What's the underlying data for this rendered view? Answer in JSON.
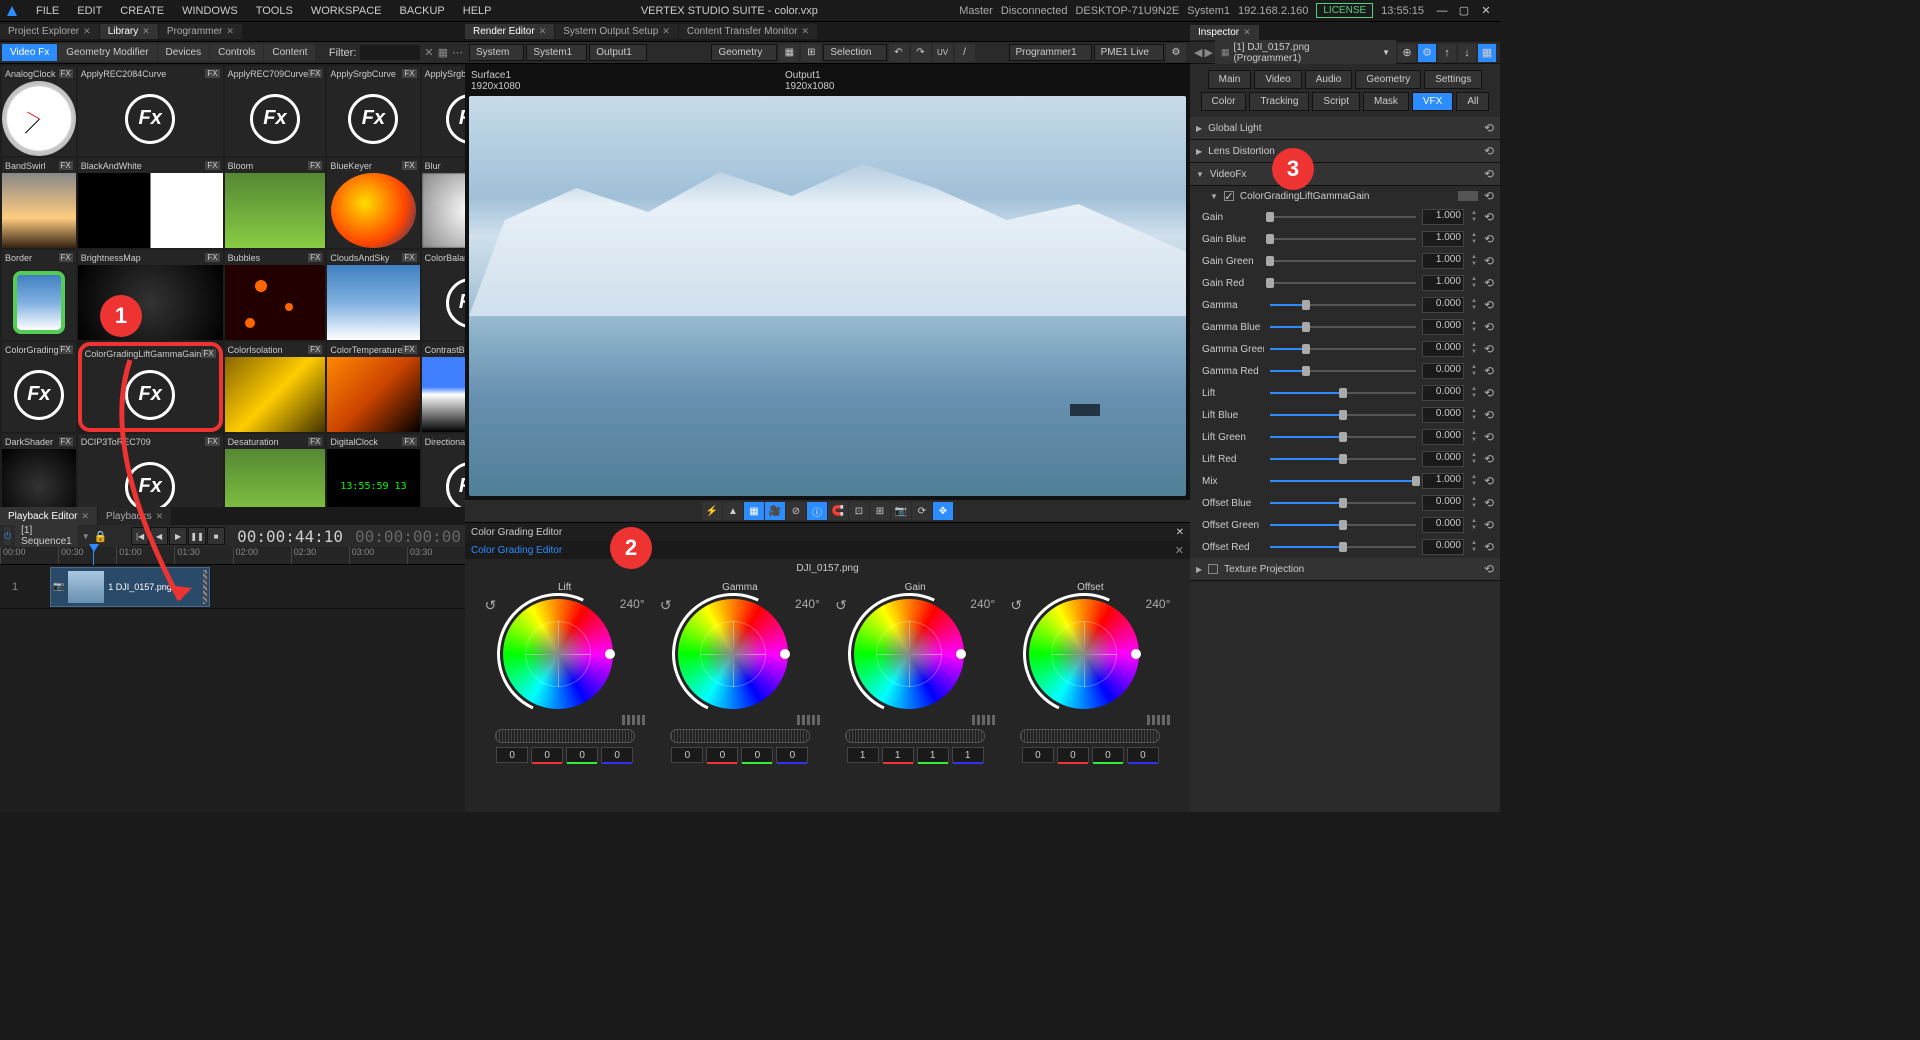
{
  "app": {
    "title": "VERTEX STUDIO SUITE - color.vxp",
    "status_master": "Master",
    "status_disconnected": "Disconnected",
    "status_machine": "DESKTOP-71U9N2E",
    "status_system": "System1",
    "status_ip": "192.168.2.160",
    "license": "LICENSE",
    "clock": "13:55:15"
  },
  "menu": [
    "FILE",
    "EDIT",
    "CREATE",
    "WINDOWS",
    "TOOLS",
    "WORKSPACE",
    "BACKUP",
    "HELP"
  ],
  "left_panel": {
    "tabs": [
      "Project Explorer",
      "Library",
      "Programmer"
    ],
    "active_tab": 1,
    "sub_tabs": [
      "Video Fx",
      "Geometry Modifier",
      "Devices",
      "Controls",
      "Content"
    ],
    "active_sub": 0,
    "filter_label": "Filter:",
    "fx_items": [
      {
        "name": "AnalogClock",
        "thumb": "clock"
      },
      {
        "name": "ApplyREC2084Curve",
        "thumb": "fx"
      },
      {
        "name": "ApplyREC709Curve",
        "thumb": "fx"
      },
      {
        "name": "ApplySrgbCurve",
        "thumb": "fx"
      },
      {
        "name": "ApplySrgbCurveInv",
        "thumb": "fx"
      },
      {
        "name": "BandSwirl",
        "thumb": "sunset"
      },
      {
        "name": "BlackAndWhite",
        "thumb": "bw"
      },
      {
        "name": "Bloom",
        "thumb": "green"
      },
      {
        "name": "BlueKeyer",
        "thumb": "apple"
      },
      {
        "name": "Blur",
        "thumb": "blur"
      },
      {
        "name": "Border",
        "thumb": "sky",
        "green_box": true
      },
      {
        "name": "BrightnessMap",
        "thumb": "dark"
      },
      {
        "name": "Bubbles",
        "thumb": "bubbles"
      },
      {
        "name": "CloudsAndSky",
        "thumb": "sky"
      },
      {
        "name": "ColorBalance",
        "thumb": "fx"
      },
      {
        "name": "ColorGrading",
        "thumb": "fx"
      },
      {
        "name": "ColorGradingLiftGammaGain",
        "thumb": "fx",
        "highlighted": true
      },
      {
        "name": "ColorIsolation",
        "thumb": "flower"
      },
      {
        "name": "ColorTemperature",
        "thumb": "orange"
      },
      {
        "name": "ContrastBrightness",
        "thumb": "contrast"
      },
      {
        "name": "DarkShader",
        "thumb": "dark"
      },
      {
        "name": "DCIP3ToREC709",
        "thumb": "fx"
      },
      {
        "name": "Desaturation",
        "thumb": "green"
      },
      {
        "name": "DigitalClock",
        "thumb": "digital",
        "digital_text": "13:55:59  13"
      },
      {
        "name": "DirectionalBlur",
        "thumb": "fx"
      }
    ]
  },
  "playback": {
    "tabs": [
      "Playback Editor",
      "Playbacks"
    ],
    "sequence": "[1] Sequence1",
    "timecode": "00:00:44:10",
    "timecode2": "00:00:00:00",
    "ruler": [
      "00:00",
      "00:30",
      "01:00",
      "01:30",
      "02:00",
      "02:30",
      "03:00",
      "03:30"
    ],
    "track_num": "1",
    "clip_name": "1 DJI_0157.png",
    "clip_side": "Camera1"
  },
  "render": {
    "tabs": [
      "Render Editor",
      "System Output Setup",
      "Content Transfer Monitor"
    ],
    "tb_system": "System",
    "tb_system1": "System1",
    "tb_output1": "Output1",
    "tb_geometry": "Geometry",
    "tb_selection": "Selection",
    "tb_programmer": "Programmer1",
    "tb_pme": "PME1 Live",
    "surface_name": "Surface1",
    "surface_res": "1920x1080",
    "output_name": "Output1",
    "output_res": "1920x1080"
  },
  "color_grading": {
    "title": "Color Grading Editor",
    "tab": "Color Grading Editor",
    "filename": "DJI_0157.png",
    "wheels": [
      {
        "name": "Lift",
        "deg": "240°",
        "v1": "0",
        "v2": "0",
        "v3": "0",
        "v4": "0"
      },
      {
        "name": "Gamma",
        "deg": "240°",
        "v1": "0",
        "v2": "0",
        "v3": "0",
        "v4": "0"
      },
      {
        "name": "Gain",
        "deg": "240°",
        "v1": "1",
        "v2": "1",
        "v3": "1",
        "v4": "1"
      },
      {
        "name": "Offset",
        "deg": "240°",
        "v1": "0",
        "v2": "0",
        "v3": "0",
        "v4": "0"
      }
    ]
  },
  "inspector": {
    "tab": "Inspector",
    "selection": "[1] DJI_0157.png (Programmer1)",
    "modes_row1": [
      "Main",
      "Video",
      "Audio",
      "Geometry",
      "Settings",
      "Color"
    ],
    "modes_row2": [
      "Tracking",
      "Script",
      "Mask",
      "VFX",
      "All"
    ],
    "active_mode": "VFX",
    "sections": [
      {
        "title": "Global Light",
        "open": false
      },
      {
        "title": "Lens Distortion",
        "open": false
      },
      {
        "title": "VideoFx",
        "open": true
      }
    ],
    "fx_name": "ColorGradingLiftGammaGain",
    "props": [
      {
        "label": "Gain",
        "value": "1.000",
        "pos": 0
      },
      {
        "label": "Gain Blue",
        "value": "1.000",
        "pos": 0
      },
      {
        "label": "Gain Green",
        "value": "1.000",
        "pos": 0
      },
      {
        "label": "Gain Red",
        "value": "1.000",
        "pos": 0
      },
      {
        "label": "Gamma",
        "value": "0.000",
        "pos": 25
      },
      {
        "label": "Gamma Blue",
        "value": "0.000",
        "pos": 25
      },
      {
        "label": "Gamma Green",
        "value": "0.000",
        "pos": 25
      },
      {
        "label": "Gamma Red",
        "value": "0.000",
        "pos": 25
      },
      {
        "label": "Lift",
        "value": "0.000",
        "pos": 50
      },
      {
        "label": "Lift Blue",
        "value": "0.000",
        "pos": 50
      },
      {
        "label": "Lift Green",
        "value": "0.000",
        "pos": 50
      },
      {
        "label": "Lift Red",
        "value": "0.000",
        "pos": 50
      },
      {
        "label": "Mix",
        "value": "1.000",
        "pos": 100
      },
      {
        "label": "Offset Blue",
        "value": "0.000",
        "pos": 50
      },
      {
        "label": "Offset Green",
        "value": "0.000",
        "pos": 50
      },
      {
        "label": "Offset Red",
        "value": "0.000",
        "pos": 50
      }
    ],
    "texture_section": "Texture Projection"
  },
  "annotations": {
    "n1": "1",
    "n2": "2",
    "n3": "3"
  }
}
